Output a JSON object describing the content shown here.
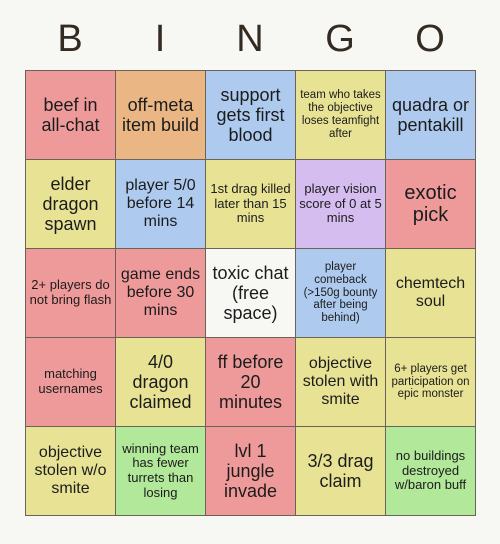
{
  "header": {
    "letters": [
      "B",
      "I",
      "N",
      "G",
      "O"
    ]
  },
  "palette": {
    "page_background": "#f7f7f4",
    "grid_line": "#6b6258",
    "red": "#ef9a9a",
    "orange": "#eab684",
    "blue": "#aecbef",
    "yellow": "#e8e394",
    "purple": "#d6bdf0",
    "green": "#b2e89a",
    "free": "#f7f7f4",
    "text": "#1c1c1c",
    "header_text": "#332b22"
  },
  "grid": {
    "rows": 5,
    "cols": 5,
    "cells": [
      {
        "text": "beef in all-chat",
        "color": "red",
        "size": "lg"
      },
      {
        "text": "off-meta item build",
        "color": "orange",
        "size": "lg"
      },
      {
        "text": "support gets first blood",
        "color": "blue",
        "size": "lg"
      },
      {
        "text": "team who takes the objective loses teamfight after",
        "color": "yellow",
        "size": "xs"
      },
      {
        "text": "quadra or pentakill",
        "color": "blue",
        "size": "lg"
      },
      {
        "text": "elder dragon spawn",
        "color": "yellow",
        "size": "lg"
      },
      {
        "text": "player 5/0 before 14 mins",
        "color": "blue",
        "size": "md"
      },
      {
        "text": "1st drag killed later than 15 mins",
        "color": "yellow",
        "size": "sm"
      },
      {
        "text": "player vision score of 0 at 5 mins",
        "color": "purple",
        "size": "sm"
      },
      {
        "text": "exotic pick",
        "color": "red",
        "size": "xl"
      },
      {
        "text": "2+ players do not bring flash",
        "color": "red",
        "size": "sm"
      },
      {
        "text": "game ends before 30 mins",
        "color": "red",
        "size": "md"
      },
      {
        "text": "toxic chat (free space)",
        "color": "free",
        "size": "lg"
      },
      {
        "text": "player comeback (>150g bounty after being behind)",
        "color": "blue",
        "size": "xs"
      },
      {
        "text": "chemtech soul",
        "color": "yellow",
        "size": "md"
      },
      {
        "text": "matching usernames",
        "color": "red",
        "size": "sm"
      },
      {
        "text": "4/0 dragon claimed",
        "color": "yellow",
        "size": "lg"
      },
      {
        "text": "ff before 20 minutes",
        "color": "red",
        "size": "lg"
      },
      {
        "text": "objective stolen with smite",
        "color": "yellow",
        "size": "md"
      },
      {
        "text": "6+ players get participation on epic monster",
        "color": "yellow",
        "size": "xs"
      },
      {
        "text": "objective stolen w/o smite",
        "color": "yellow",
        "size": "md"
      },
      {
        "text": "winning team has fewer turrets than losing",
        "color": "green",
        "size": "sm"
      },
      {
        "text": "lvl 1 jungle invade",
        "color": "red",
        "size": "lg"
      },
      {
        "text": "3/3 drag claim",
        "color": "yellow",
        "size": "lg"
      },
      {
        "text": "no buildings destroyed w/baron buff",
        "color": "green",
        "size": "sm"
      }
    ]
  }
}
